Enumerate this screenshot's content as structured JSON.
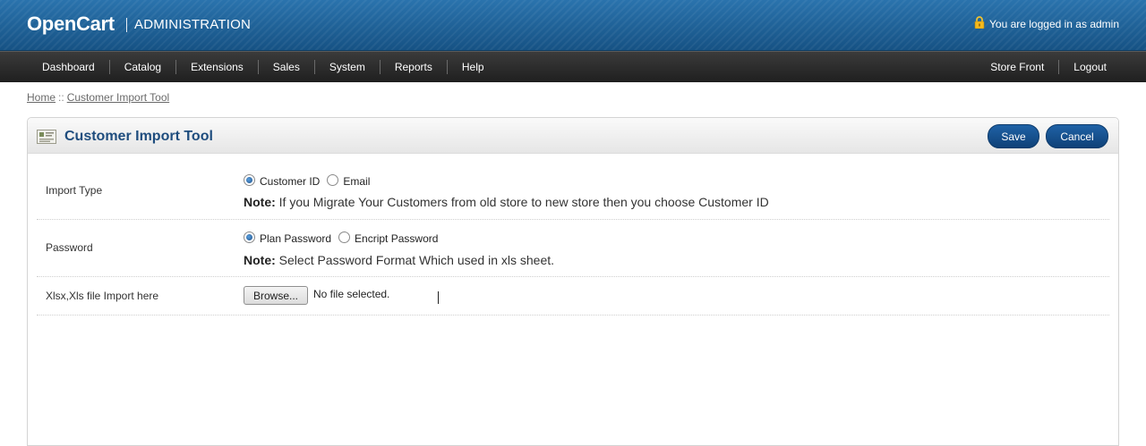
{
  "header": {
    "logo": "OpenCart",
    "title": "ADMINISTRATION",
    "login_text": "You are logged in as admin",
    "lock_icon": "lock-icon"
  },
  "menu": {
    "left": [
      "Dashboard",
      "Catalog",
      "Extensions",
      "Sales",
      "System",
      "Reports",
      "Help"
    ],
    "right": [
      "Store Front",
      "Logout"
    ]
  },
  "breadcrumb": {
    "home": "Home",
    "separator": "::",
    "current": "Customer Import Tool"
  },
  "box": {
    "title": "Customer Import Tool",
    "icon": "module-icon",
    "save_label": "Save",
    "cancel_label": "Cancel"
  },
  "form": {
    "import_type": {
      "label": "Import Type",
      "options": [
        {
          "label": "Customer ID",
          "checked": true
        },
        {
          "label": "Email",
          "checked": false
        }
      ],
      "note_bold": "Note:",
      "note_text": " If you Migrate Your Customers from old store to new store then you choose Customer ID"
    },
    "password": {
      "label": "Password",
      "options": [
        {
          "label": "Plan Password",
          "checked": true
        },
        {
          "label": "Encript Password",
          "checked": false
        }
      ],
      "note_bold": "Note:",
      "note_text": " Select Password Format Which used in xls sheet."
    },
    "file": {
      "label": "Xlsx,Xls file Import here",
      "browse_label": "Browse...",
      "status": "No file selected."
    }
  },
  "colors": {
    "header_blue": "#1d5d8f",
    "menu_dark": "#2b2b2b",
    "title_blue": "#1f4d7e",
    "button_blue": "#1a5796"
  }
}
